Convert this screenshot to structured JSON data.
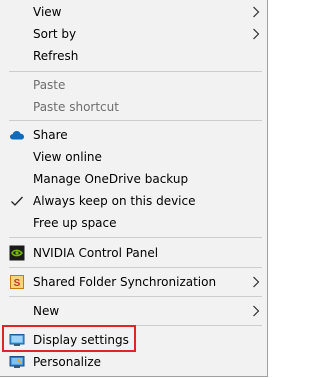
{
  "menu": {
    "view": "View",
    "sort_by": "Sort by",
    "refresh": "Refresh",
    "paste": "Paste",
    "paste_shortcut": "Paste shortcut",
    "share": "Share",
    "view_online": "View online",
    "manage_onedrive_backup": "Manage OneDrive backup",
    "always_keep": "Always keep on this device",
    "free_up_space": "Free up space",
    "nvidia": "NVIDIA Control Panel",
    "shared_folder_sync": "Shared Folder Synchronization",
    "new": "New",
    "display_settings": "Display settings",
    "personalize": "Personalize"
  },
  "icons": {
    "share": "onedrive-cloud-icon",
    "always_keep": "checkmark-icon",
    "nvidia": "nvidia-logo-icon",
    "shared_folder_sync": "sync-app-icon",
    "display_settings": "monitor-icon",
    "personalize": "personalize-monitor-icon",
    "submenu": "chevron-right-icon"
  },
  "colors": {
    "menu_background": "#f2f2f2",
    "highlight_border": "#e0242c",
    "disabled_text": "#6d6d6d",
    "onedrive_blue": "#0f6cbd",
    "nvidia_green": "#76b900"
  }
}
